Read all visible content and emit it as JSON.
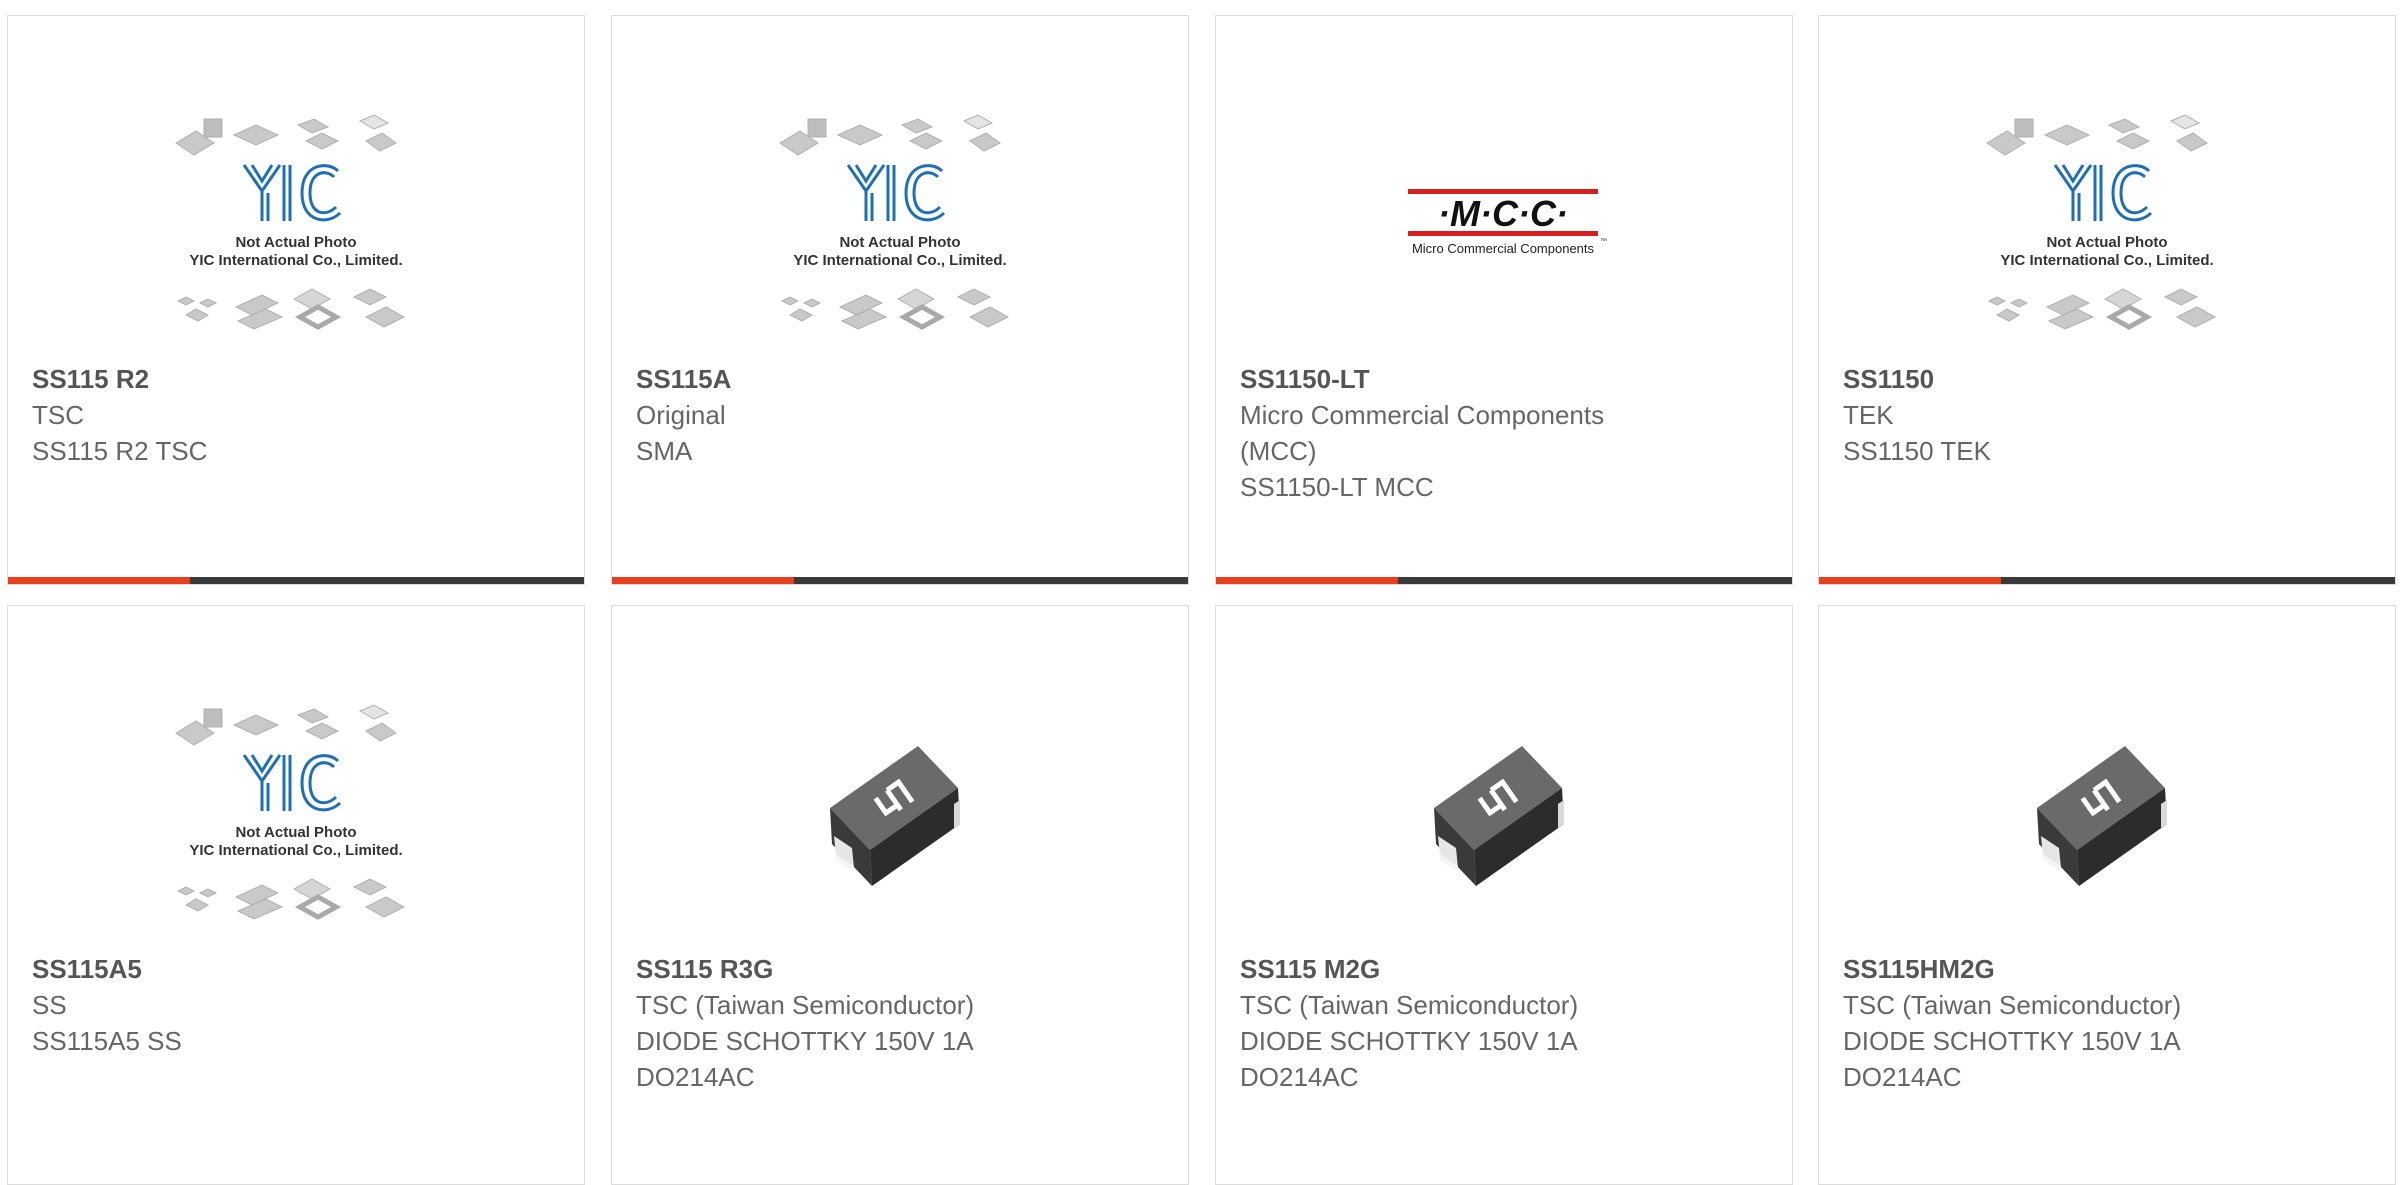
{
  "placeholder": {
    "caption_line1": "Not Actual Photo",
    "caption_line2": "YIC International Co., Limited.",
    "logo": "YIC"
  },
  "mcc_logo": {
    "mark": "·M·C·C·",
    "subtitle": "Micro Commercial Components",
    "tm": "™"
  },
  "colors": {
    "accent": "#e8401c",
    "bar": "#3a3a3a",
    "border": "#dcdcdc",
    "yic_blue": "#1e6fb8",
    "mcc_red": "#d6201f"
  },
  "products": [
    {
      "name": "SS115 R2",
      "lines": [
        "TSC",
        "SS115 R2 TSC"
      ],
      "image": "yic-placeholder"
    },
    {
      "name": "SS115A",
      "lines": [
        "Original",
        "SMA"
      ],
      "image": "yic-placeholder"
    },
    {
      "name": "SS1150-LT",
      "lines": [
        "Micro Commercial Components",
        "(MCC)",
        "SS1150-LT MCC"
      ],
      "image": "mcc-logo"
    },
    {
      "name": "SS1150",
      "lines": [
        "TEK",
        "SS1150 TEK"
      ],
      "image": "yic-placeholder"
    },
    {
      "name": "SS115A5",
      "lines": [
        "SS",
        "SS115A5 SS"
      ],
      "image": "yic-placeholder"
    },
    {
      "name": "SS115 R3G",
      "lines": [
        "TSC (Taiwan Semiconductor)",
        "DIODE SCHOTTKY 150V 1A",
        "DO214AC"
      ],
      "image": "diode-photo"
    },
    {
      "name": "SS115 M2G",
      "lines": [
        "TSC (Taiwan Semiconductor)",
        "DIODE SCHOTTKY 150V 1A",
        "DO214AC"
      ],
      "image": "diode-photo"
    },
    {
      "name": "SS115HM2G",
      "lines": [
        "TSC (Taiwan Semiconductor)",
        "DIODE SCHOTTKY 150V 1A",
        "DO214AC"
      ],
      "image": "diode-photo"
    }
  ]
}
